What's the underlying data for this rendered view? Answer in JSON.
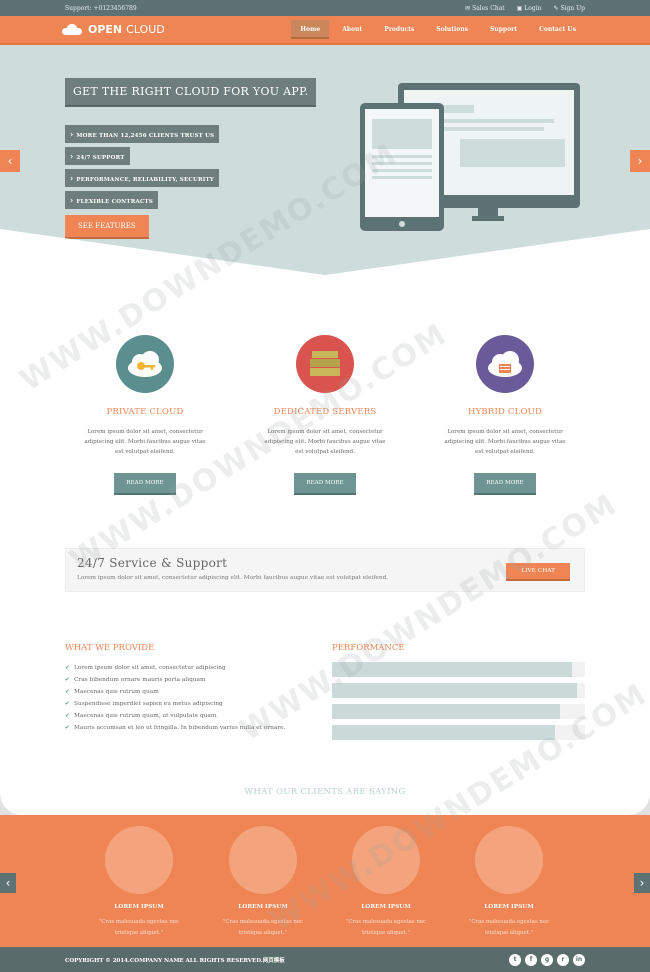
{
  "topbar": {
    "support": "Support: +0123456789",
    "links": [
      "Sales Chat",
      "Login",
      "Sign Up"
    ]
  },
  "nav": {
    "logo_bold": "OPEN",
    "logo_light": "CLOUD",
    "items": [
      "Home",
      "About",
      "Products",
      "Solutions",
      "Support",
      "Contact Us"
    ],
    "active": "Home"
  },
  "hero": {
    "title": "GET THE RIGHT CLOUD FOR YOU APP.",
    "features": [
      "MORE THAN 12,2456 CLIENTS TRUST US",
      "24/7 SUPPORT",
      "PERFORMANCE, RELIABILITY, SECURITY",
      "FLEXIBLE CONTRACTS"
    ],
    "cta": "SEE FEATURES",
    "prev_icon": "chevron-left-icon",
    "next_icon": "chevron-right-icon"
  },
  "services": [
    {
      "title": "PRIVATE CLOUD",
      "icon": "cloud-key-icon",
      "color": "#5b8f8f",
      "text": "Lorem ipsum dolor sit amet, consectetur adipiscing elit. Morbi faucibus augue vitae est volutpat eleifend.",
      "button": "READ MORE"
    },
    {
      "title": "DEDICATED SERVERS",
      "icon": "server-stack-icon",
      "color": "#d9534f",
      "text": "Lorem ipsum dolor sit amet, consectetur adipiscing elit. Morbi faucibus augue vitae est volutpat eleifend.",
      "button": "READ MORE"
    },
    {
      "title": "HYBRID CLOUD",
      "icon": "cloud-server-icon",
      "color": "#6a5a9a",
      "text": "Lorem ipsum dolor sit amet, consectetur adipiscing elit. Morbi faucibus augue vitae est volutpat eleifend.",
      "button": "READ MORE"
    }
  ],
  "support": {
    "title": "24/7 Service & Support",
    "text": "Lorem ipsum dolor sit amet, consectetur adipiscing elit. Morbi faucibus augue vitae est volutpat eleifend.",
    "button": "LIVE CHAT"
  },
  "provide": {
    "title": "WHAT WE PROVIDE",
    "items": [
      "Lorem ipsum dolor sit amet, consectetur adipiscing",
      "Cras bibendum ornare mauris porta aliquam",
      "Maecenas quis rutrum quam",
      "Suspendisse imperdiet sapien eu metus adipiscing",
      "Maecenas quis rutrum quam, ut vulputate quam.",
      "Mauris accumsan et leo ut fringilla. In bibendum varius nulla et ornare."
    ]
  },
  "performance": {
    "title": "PERFORMANCE",
    "levels": [
      0.95,
      0.97,
      0.9,
      0.88
    ]
  },
  "clients": {
    "title": "WHAT OUR CLIENTS ARE SAYING",
    "items": [
      {
        "name": "LOREM IPSUM",
        "quote": "\"Cras malesuada egestas nec tristique aliquet.\""
      },
      {
        "name": "LOREM IPSUM",
        "quote": "\"Cras malesuada egestas nec tristique aliquet.\""
      },
      {
        "name": "LOREM IPSUM",
        "quote": "\"Cras malesuada egestas nec tristique aliquet.\""
      },
      {
        "name": "LOREM IPSUM",
        "quote": "\"Cras malesuada egestas nec tristique aliquet.\""
      }
    ]
  },
  "footer": {
    "copyright": "COPYRIGHT © 2014.COMPANY NAME ALL RIGHTS RESERVED.网页模板",
    "socials": [
      "twitter-icon",
      "facebook-icon",
      "google-plus-icon",
      "rss-icon",
      "linkedin-icon"
    ]
  },
  "watermark": "WWW.DOWNDEMO.COM",
  "colors": {
    "accent": "#ef8554",
    "teal": "#6e9494",
    "slate": "#5d7373"
  }
}
